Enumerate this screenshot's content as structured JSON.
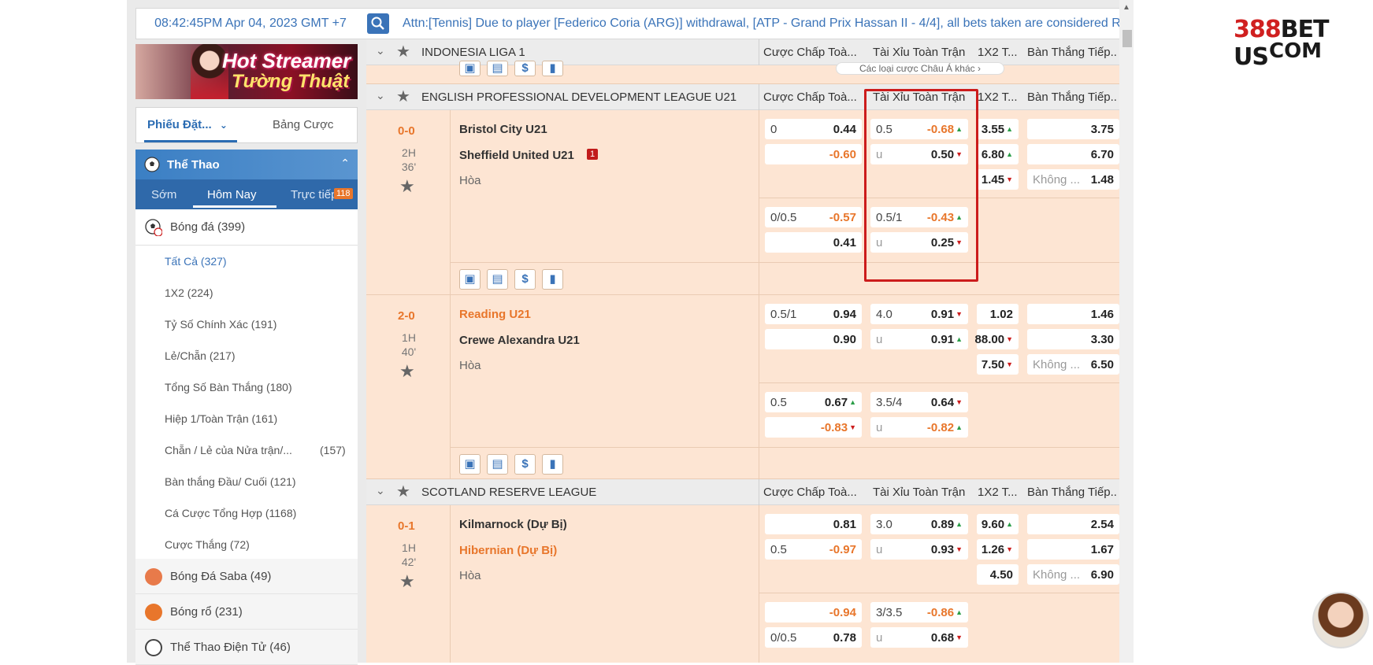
{
  "topbar": {
    "clock": "08:42:45PM Apr 04, 2023 GMT +7",
    "ticker": "Attn:[Tennis] Due to player [Federico Coria (ARG)] withdrawal, [ATP - Grand Prix Hassan II - 4/4], all bets taken are considered Rl"
  },
  "sidebar": {
    "banner": {
      "line1": "Hot Streamer",
      "line2": "Tường Thuật"
    },
    "betslip": {
      "tab1": "Phiếu Đặt...",
      "tab2": "Bảng Cược"
    },
    "sports_header": "Thể Thao",
    "tabs": [
      "Sớm",
      "Hôm Nay",
      "Trực tiếp"
    ],
    "live_badge": "118",
    "soccer": "Bóng đá (399)",
    "sub_items": [
      "Tất Cả (327)",
      "1X2 (224)",
      "Tỷ Số Chính Xác (191)",
      "Lẻ/Chẵn (217)",
      "Tổng Số Bàn Thắng (180)",
      "Hiệp 1/Toàn Trận (161)",
      "Chẵn / Lẻ của Nửa trận/...",
      "Bàn thắng Đầu/ Cuối (121)",
      "Cá Cược Tổng Hợp (1168)",
      "Cược Thắng (72)"
    ],
    "sub_item_7_count": "(157)",
    "other_sports": [
      "Bóng Đá Saba (49)",
      "Bóng rổ (231)",
      "Thể Thao Điện Tử (46)"
    ]
  },
  "col_headers": [
    "Cược Chấp Toà...",
    "Tài Xỉu Toàn Trận",
    "1X2 T...",
    "Bàn Thắng Tiếp..."
  ],
  "leagues": [
    "INDONESIA LIGA 1",
    "ENGLISH PROFESSIONAL DEVELOPMENT LEAGUE U21",
    "SCOTLAND RESERVE LEAGUE"
  ],
  "indonesia_dropdown": "Các loại cược Châu Á khác",
  "matches": [
    {
      "score": "0-0",
      "half": "2H",
      "minute": "36'",
      "home": "Bristol City U21",
      "away": "Sheffield United U21",
      "red_card": "1",
      "draw": "Hòa",
      "hdp1": {
        "line": "0",
        "home": "0.44",
        "away": "-0.60"
      },
      "ou1": {
        "line": "0.5",
        "over": "-0.68",
        "u": "u",
        "under": "0.50"
      },
      "x12": [
        "3.55",
        "6.80",
        "1.45"
      ],
      "next": [
        "3.75",
        "6.70",
        "Không ...",
        "1.48"
      ],
      "hdp2": {
        "line": "0/0.5",
        "home": "-0.57",
        "away": "0.41"
      },
      "ou2": {
        "line": "0.5/1",
        "over": "-0.43",
        "u": "u",
        "under": "0.25"
      }
    },
    {
      "score": "2-0",
      "half": "1H",
      "minute": "40'",
      "home": "Reading U21",
      "away": "Crewe Alexandra U21",
      "draw": "Hòa",
      "hdp1": {
        "line": "0.5/1",
        "home": "0.94",
        "away": "0.90"
      },
      "ou1": {
        "line": "4.0",
        "over": "0.91",
        "u": "u",
        "under": "0.91"
      },
      "x12": [
        "1.02",
        "88.00",
        "7.50"
      ],
      "next": [
        "1.46",
        "3.30",
        "Không ...",
        "6.50"
      ],
      "hdp2": {
        "line": "0.5",
        "home": "0.67",
        "away": "-0.83"
      },
      "ou2": {
        "line": "3.5/4",
        "over": "0.64",
        "u": "u",
        "under": "-0.82"
      }
    },
    {
      "score": "0-1",
      "half": "1H",
      "minute": "42'",
      "home": "Kilmarnock (Dự Bị)",
      "away": "Hibernian (Dự Bị)",
      "draw": "Hòa",
      "hdp1": {
        "line": "0.5",
        "home": "0.81",
        "away": "-0.97"
      },
      "ou1": {
        "line": "3.0",
        "over": "0.89",
        "u": "u",
        "under": "0.93"
      },
      "x12": [
        "9.60",
        "1.26",
        "4.50"
      ],
      "next": [
        "2.54",
        "1.67",
        "Không ...",
        "6.90"
      ],
      "hdp2": {
        "line": "0/0.5",
        "home": "-0.94",
        "away": "0.78"
      },
      "ou2": {
        "line": "3/3.5",
        "over": "-0.86",
        "u": "u",
        "under": "0.68"
      }
    }
  ],
  "logo": {
    "line1a": "388",
    "line1b": "BET US",
    "line2": "COM"
  },
  "colors": {
    "accent": "#3a73b8",
    "orange": "#e8762b",
    "highlight": "#cc1c1c",
    "row_bg": "#fde5d3"
  }
}
